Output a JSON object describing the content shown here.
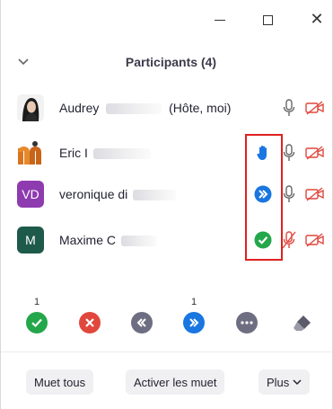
{
  "window": {
    "controls": [
      "minimize",
      "maximize",
      "close"
    ]
  },
  "panel": {
    "title": "Participants (4)"
  },
  "participants": [
    {
      "name": "Audrey",
      "suffix": "(Hôte, moi)",
      "avatar": "photo",
      "status_icon": "none",
      "mic": "on",
      "video": "off"
    },
    {
      "name": "Eric I",
      "avatar": "logo-m",
      "status_icon": "raise-hand",
      "mic": "on",
      "video": "off"
    },
    {
      "name": "veronique di",
      "avatar_initials": "VD",
      "avatar_color": "#8e3bb0",
      "status_icon": "go-faster",
      "mic": "on",
      "video": "off"
    },
    {
      "name": "Maxime C",
      "avatar_initials": "M",
      "avatar_color": "#1e5a4a",
      "status_icon": "yes",
      "mic": "muted",
      "video": "off"
    }
  ],
  "reactions": [
    {
      "name": "yes",
      "count": "1",
      "color": "#23a74a"
    },
    {
      "name": "no",
      "count": "",
      "color": "#e0473d"
    },
    {
      "name": "go-slower",
      "count": "",
      "color": "#6e6e82"
    },
    {
      "name": "go-faster",
      "count": "1",
      "color": "#1a76e0"
    },
    {
      "name": "more",
      "count": "",
      "color": "#6e6e82"
    },
    {
      "name": "clear",
      "count": "",
      "color": "#5b5b6b"
    }
  ],
  "footer": {
    "mute_all": "Muet tous",
    "unmute_all": "Activer les muet",
    "more": "Plus"
  },
  "colors": {
    "accent": "#1a76e0",
    "alert": "#e02020",
    "muted": "#e0473d"
  }
}
